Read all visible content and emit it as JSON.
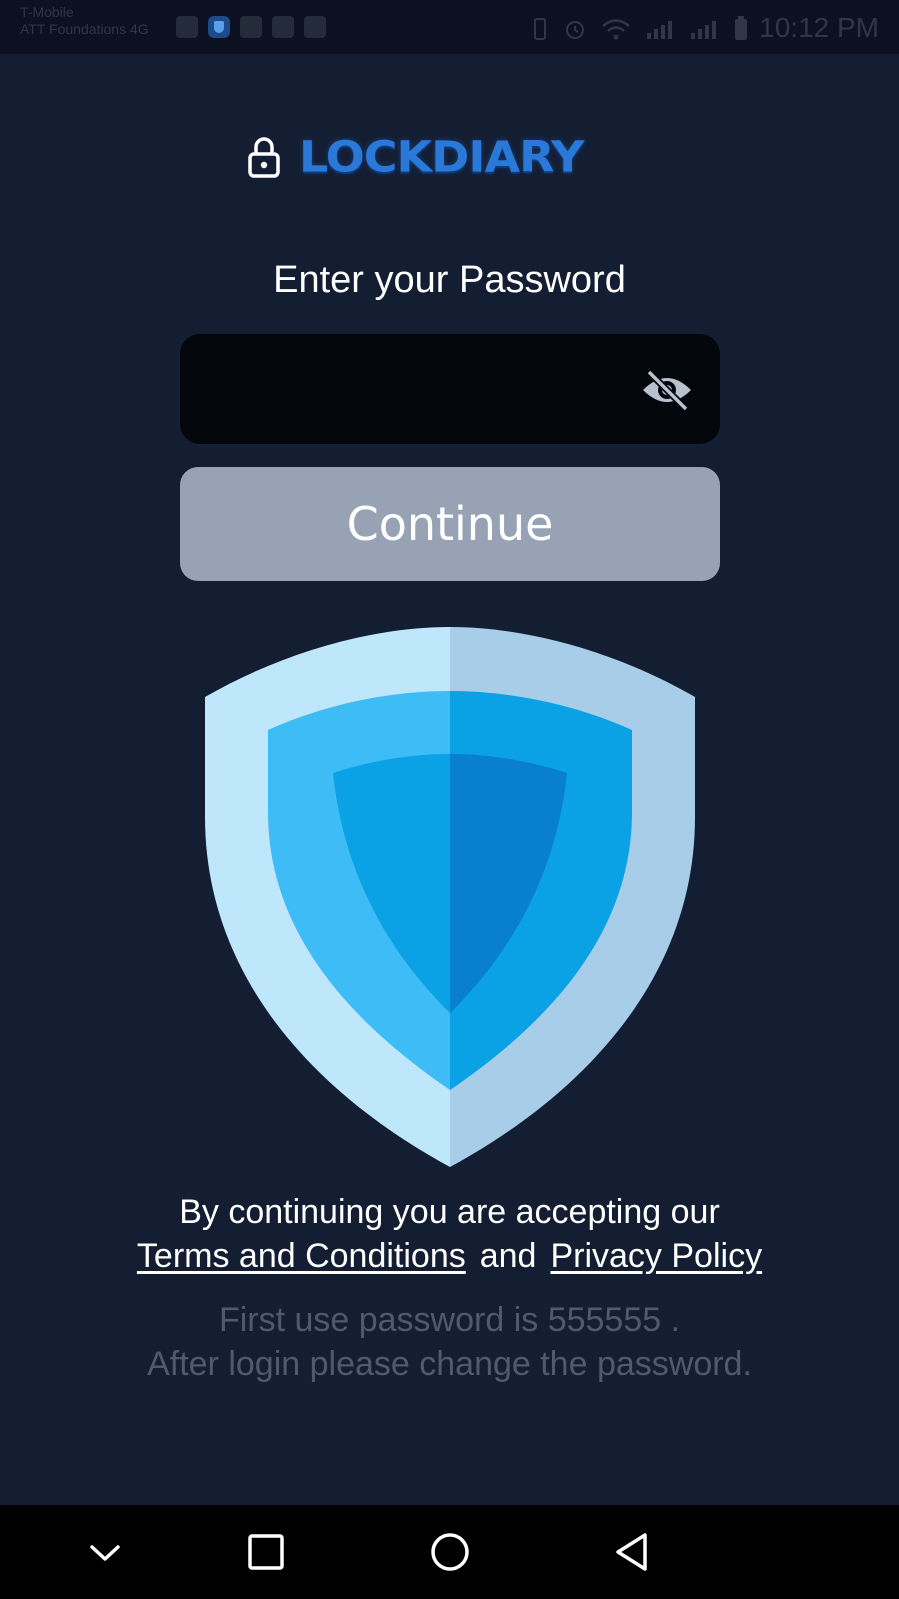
{
  "status_bar": {
    "carrier_line1": "T-Mobile",
    "carrier_line2": "ATT Foundations 4G",
    "time": "10:12 PM"
  },
  "app": {
    "logo_text": "LOCKDIARY",
    "title": "Enter your Password",
    "password_placeholder": "",
    "continue_label": "Continue"
  },
  "terms": {
    "prefix": "By continuing you are accepting our",
    "terms_link": "Terms and Conditions",
    "conjunction": "and",
    "privacy_link": "Privacy Policy"
  },
  "hint": {
    "line1": "First use password is 555555 .",
    "line2": "After login please change  the password."
  },
  "icons": {
    "lock": "lock-icon",
    "eye": "eye-off-icon",
    "shield": "shield-illustration",
    "nav_back": "triangle-back-icon",
    "nav_home": "circle-home-icon",
    "nav_recents": "square-recents-icon",
    "nav_down": "chevron-down-icon"
  },
  "colors": {
    "background": "#141e33",
    "field": "#03060b",
    "button": "#97a3b5",
    "logo": "#2a78d8",
    "hint_text": "#4f5a6d"
  }
}
